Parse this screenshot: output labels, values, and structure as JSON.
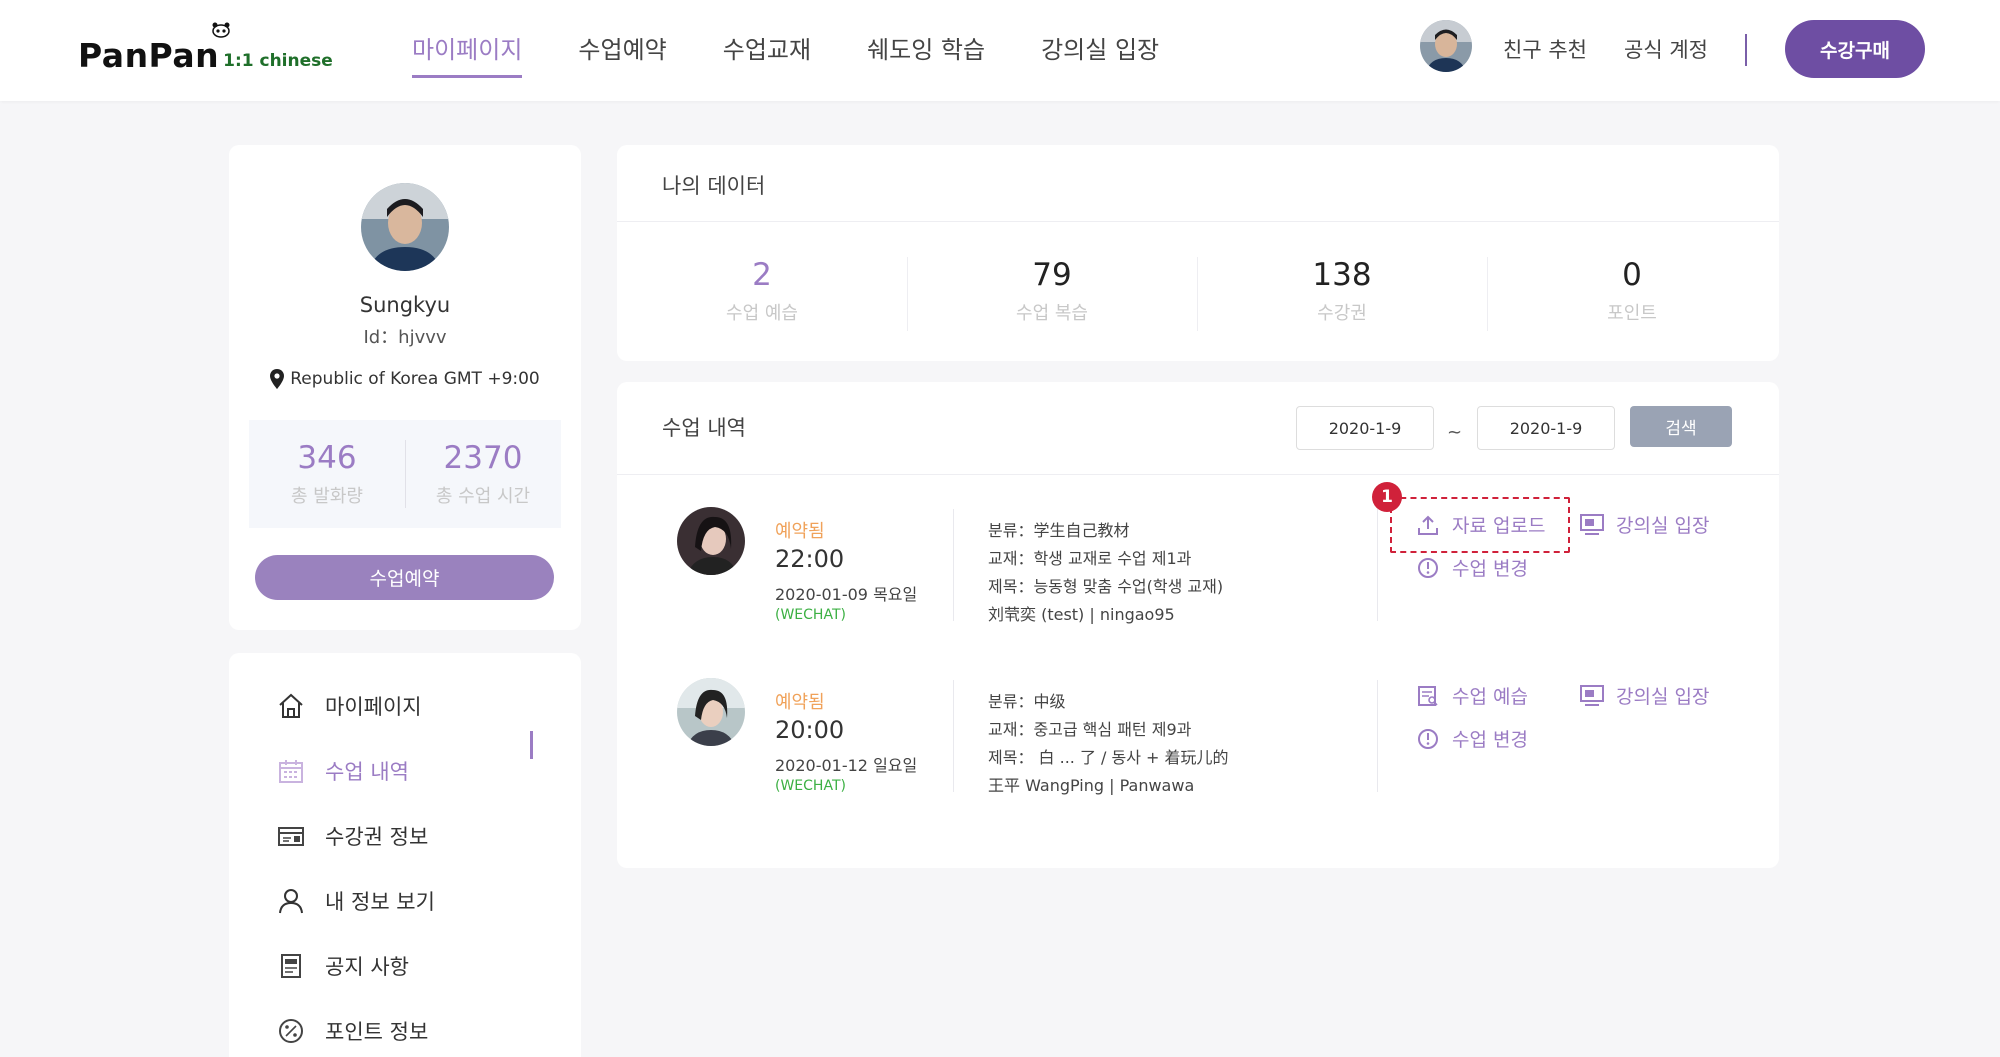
{
  "brand": {
    "name": "PanPan",
    "tagline": "1:1 chinese"
  },
  "nav": [
    {
      "label": "마이페이지",
      "active": true
    },
    {
      "label": "수업예약"
    },
    {
      "label": "수업교재"
    },
    {
      "label": "쉐도잉 학습"
    },
    {
      "label": "강의실 입장"
    }
  ],
  "header": {
    "friend_label": "친구 추천",
    "official_label": "공식 계정",
    "buy_label": "수강구매"
  },
  "profile": {
    "name": "Sungkyu",
    "id_text": "Id：hjvvv",
    "location": "Republic of Korea GMT +9:00",
    "stats": [
      {
        "value": "346",
        "label": "총 발화량"
      },
      {
        "value": "2370",
        "label": "총 수업 시간"
      }
    ],
    "reserve_label": "수업예약"
  },
  "menu": [
    {
      "label": "마이페이지",
      "icon": "home-icon"
    },
    {
      "label": "수업 내역",
      "icon": "calendar-icon",
      "active": true
    },
    {
      "label": "수강권 정보",
      "icon": "ticket-icon"
    },
    {
      "label": "내 정보 보기",
      "icon": "user-icon"
    },
    {
      "label": "공지 사항",
      "icon": "notice-icon"
    },
    {
      "label": "포인트 정보",
      "icon": "percent-icon"
    }
  ],
  "my_data": {
    "title": "나의 데이터",
    "items": [
      {
        "value": "2",
        "label": "수업 예습"
      },
      {
        "value": "79",
        "label": "수업 복습"
      },
      {
        "value": "138",
        "label": "수강권"
      },
      {
        "value": "0",
        "label": "포인트"
      }
    ]
  },
  "history": {
    "title": "수업 내역",
    "date_from": "2020-1-9",
    "tilde": "~",
    "date_to": "2020-1-9",
    "search_label": "검색",
    "rows": [
      {
        "status": "예약됨",
        "time": "22:00",
        "date": "2020-01-09 목요일",
        "channel": "(WECHAT)",
        "category": "분류：学生自己教材",
        "textbook": "교재：학생 교재로 수업 제1과",
        "subject": "제목：능동형 맞춤 수업(학생 교재)",
        "teacher": "刘茕奕 (test)  |  ningao95",
        "actions": [
          {
            "label": "자료 업로드",
            "icon": "upload-icon"
          },
          {
            "label": "강의실 입장",
            "icon": "classroom-icon"
          },
          {
            "label": "수업 변경",
            "icon": "change-icon"
          }
        ]
      },
      {
        "status": "예약됨",
        "time": "20:00",
        "date": "2020-01-12 일요일",
        "channel": "(WECHAT)",
        "category": "분류：中级",
        "textbook": "교재：중고급 핵심 패턴 제9과",
        "subject": "제목： 白 ... 了 / 동사 + 着玩儿的",
        "teacher": "王平 WangPing  |  Panwawa",
        "actions": [
          {
            "label": "수업 예습",
            "icon": "preview-icon"
          },
          {
            "label": "강의실 입장",
            "icon": "classroom-icon"
          },
          {
            "label": "수업 변경",
            "icon": "change-icon"
          }
        ]
      }
    ]
  },
  "annotation": {
    "badge": "1"
  },
  "colors": {
    "accent": "#9b7cc4",
    "brand_button": "#6e4ea3",
    "status": "#f0a25a",
    "channel": "#3cb043",
    "highlight": "#d0213a"
  }
}
